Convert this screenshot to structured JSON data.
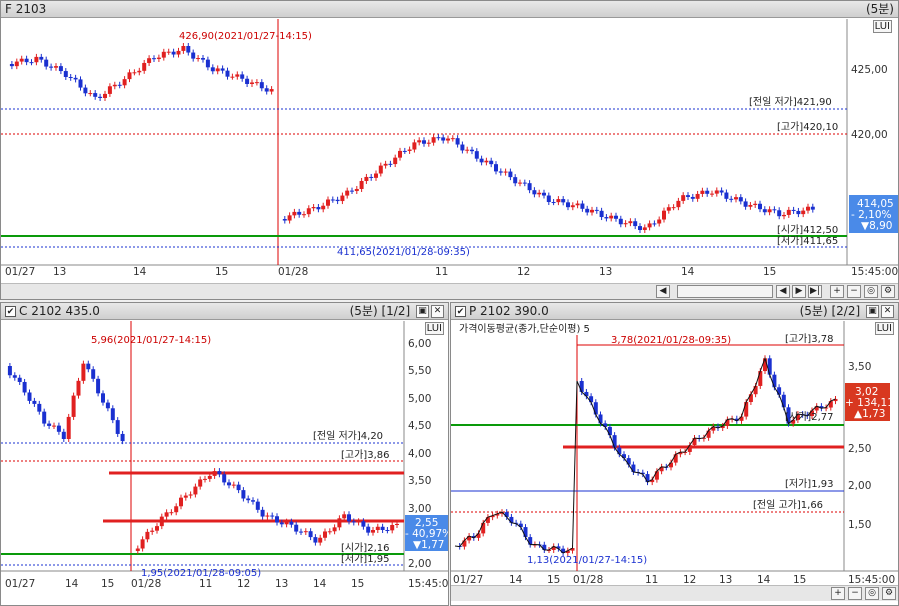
{
  "colors": {
    "up": "#e02020",
    "down": "#1a30d0",
    "green": "#0a9a0a",
    "badge_blue": "#4a8ae8",
    "badge_red": "#d83820"
  },
  "top": {
    "title": "F 2103",
    "interval": "(5분)",
    "lui": "LUI",
    "price_labels": [
      "425,00",
      "420,00"
    ],
    "annotations": {
      "high": "426,90(2021/01/27-14:15)",
      "low": "411,65(2021/01/28-09:35)",
      "prev_low": "[전일 저가]421,90",
      "day_high": "[고가]420,10",
      "open": "[시가]412,50",
      "day_low": "[저가]411,65"
    },
    "badge": [
      "414,05",
      "- 2,10%",
      "▼8,90"
    ],
    "time_labels": [
      "01/27",
      "13",
      "14",
      "15",
      "01/28",
      "11",
      "12",
      "13",
      "14",
      "15",
      "15:45:00"
    ]
  },
  "left": {
    "title": "C 2102 435.0",
    "interval": "(5분)",
    "page": "[1/2]",
    "lui": "LUI",
    "price_labels": [
      "6,00",
      "5,50",
      "5,00",
      "4,50",
      "4,00",
      "3,50",
      "3,00",
      "2,00"
    ],
    "annotations": {
      "high": "5,96(2021/01/27-14:15)",
      "low": "1,95(2021/01/28-09:05)",
      "prev_low": "[전일 저가]4,20",
      "day_high": "[고가]3,86",
      "open": "[시가]2,16",
      "day_low": "[저가]1,95"
    },
    "badge": [
      "2,55",
      "- 40,97%",
      "▼1,77"
    ],
    "time_labels": [
      "01/27",
      "14",
      "15",
      "01/28",
      "11",
      "12",
      "13",
      "14",
      "15",
      "15:45:00"
    ]
  },
  "right": {
    "title": "P 2102 390.0",
    "interval": "(5분)",
    "page": "[2/2]",
    "lui": "LUI",
    "indicator": "가격이동평균(종가,단순이평) 5",
    "price_labels": [
      "3,50",
      "2,50",
      "2,00",
      "1,50"
    ],
    "annotations": {
      "high": "3,78(2021/01/28-09:35)",
      "low": "1,13(2021/01/27-14:15)",
      "day_high": "[고가]3,78",
      "open": "[시가]2,77",
      "day_low": "[저가]1,93",
      "prev_high": "[전일 고가]1,66"
    },
    "badge": [
      "3,02",
      "+ 134,11%",
      "▲1,73"
    ],
    "time_labels": [
      "01/27",
      "14",
      "15",
      "01/28",
      "11",
      "12",
      "13",
      "14",
      "15",
      "15:45:00"
    ]
  }
}
